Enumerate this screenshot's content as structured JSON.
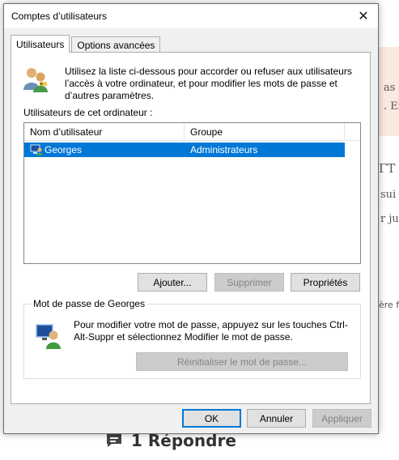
{
  "background": {
    "snippets": [
      "as la",
      ". En",
      "ΓT ▾",
      "sui",
      "r ju",
      "ère f"
    ],
    "reply_label": "1 Répondre"
  },
  "dialog": {
    "title": "Comptes d’utilisateurs",
    "close_glyph": "✕",
    "tabs": [
      {
        "label": "Utilisateurs",
        "active": true
      },
      {
        "label": "Options avancées",
        "active": false
      }
    ],
    "intro_text": "Utilisez la liste ci-dessous pour accorder ou refuser aux utilisateurs l’accès à votre ordinateur, et pour modifier les mots de passe et d’autres paramètres.",
    "users_label": "Utilisateurs de cet ordinateur :",
    "list": {
      "columns": [
        "Nom d’utilisateur",
        "Groupe"
      ],
      "rows": [
        {
          "name": "Georges",
          "group": "Administrateurs",
          "selected": true
        }
      ]
    },
    "list_buttons": {
      "add": "Ajouter...",
      "remove": "Supprimer",
      "properties": "Propriétés"
    },
    "password_group": {
      "legend": "Mot de passe de Georges",
      "text": "Pour modifier votre mot de passe, appuyez sur les touches Ctrl-Alt-Suppr et sélectionnez Modifier le mot de passe.",
      "reset_button": "Réinitialiser le mot de passe..."
    },
    "footer_buttons": {
      "ok": "OK",
      "cancel": "Annuler",
      "apply": "Appliquer"
    }
  },
  "colors": {
    "selection": "#0078d7",
    "dialog_bg": "#f0f0f0",
    "default_button_border": "#0078d7"
  },
  "icons": [
    "users-icon",
    "user-row-icon",
    "password-user-icon",
    "close-icon",
    "comment-icon"
  ]
}
